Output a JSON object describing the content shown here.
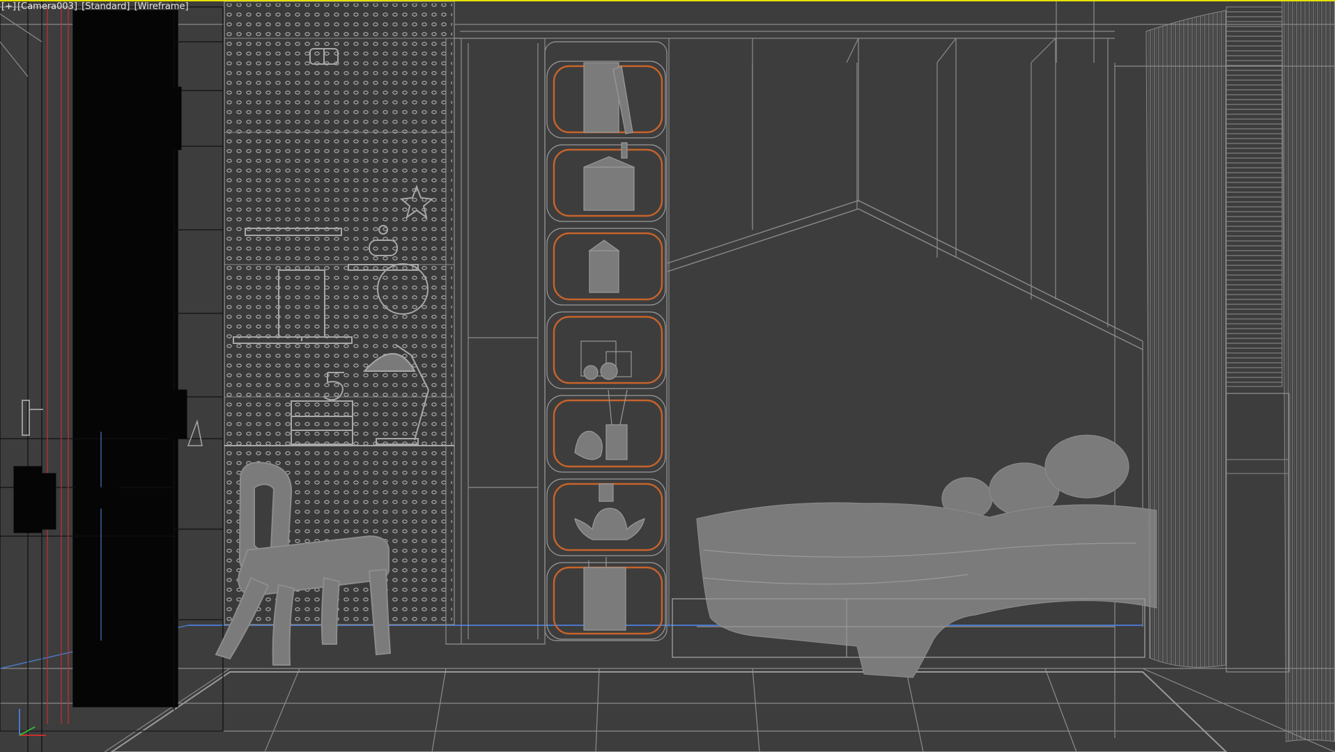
{
  "viewport": {
    "labels": {
      "menu": "[+]",
      "camera": "[Camera003]",
      "shading_standard": "[Standard]",
      "shading_mode": "[Wireframe]"
    },
    "active_border_color": "#e5e200",
    "background_color": "#3d3d3d",
    "wire_color": "#8a8a8a",
    "selected_wire_color": "#c8642a",
    "mesh_fill_color": "#7a7a7a"
  },
  "icons": {
    "axis_gizmo": "xyz-axis-icon"
  }
}
